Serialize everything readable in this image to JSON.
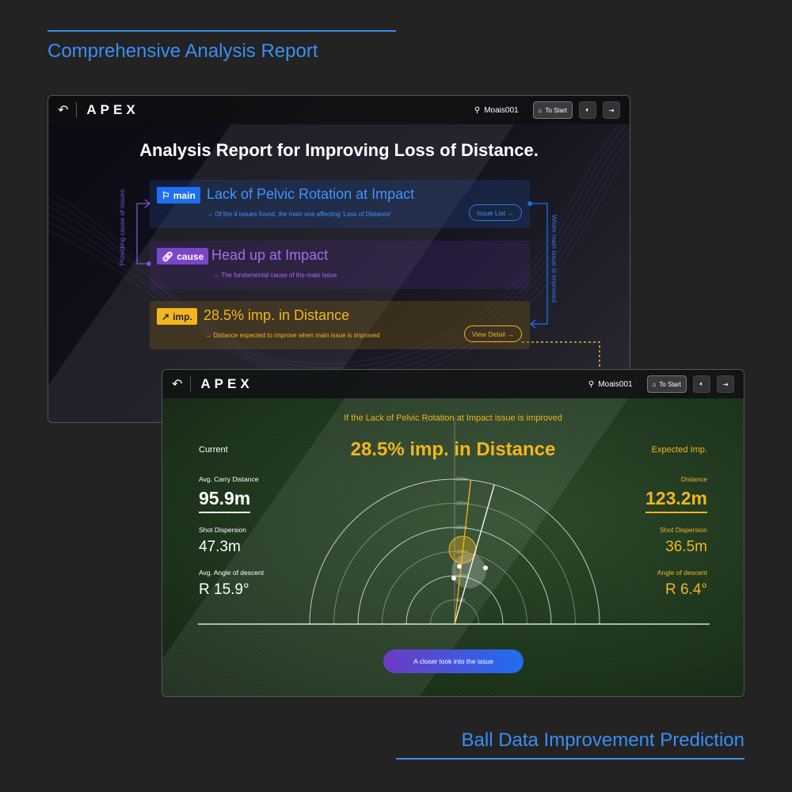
{
  "captions": {
    "top": "Comprehensive Analysis Report",
    "bottom": "Ball Data Improvement Prediction"
  },
  "header": {
    "logo": "APEX",
    "user": "Moais001",
    "to_start": "To Start"
  },
  "report": {
    "title": "Analysis Report for Improving Loss of Distance.",
    "left_flow": "Providing cause of issues",
    "right_flow": "When main issue is improved",
    "cards": [
      {
        "tag": "main",
        "title": "Lack of Pelvic Rotation at Impact",
        "sub": "Of the 4 issues found, the main one affecting 'Loss of Distance'.",
        "button": "Issue List"
      },
      {
        "tag": "cause",
        "title": "Head up at Impact",
        "sub": "The fundamental cause of the main issue"
      },
      {
        "tag": "imp.",
        "title": "28.5% imp. in Distance",
        "sub": "Distance expected to improve when main issue is improved",
        "button": "View Detail"
      }
    ]
  },
  "prediction": {
    "subtitle": "If the Lack of Pelvic Rotation at Impact issue is improved",
    "headline": "28.5% imp. in Distance",
    "current": {
      "heading": "Current",
      "items": [
        {
          "label": "Avg. Carry Distance",
          "value": "95.9m"
        },
        {
          "label": "Shot Dispersion",
          "value": "47.3m"
        },
        {
          "label": "Avg. Angle of descent",
          "value": "R 15.9°"
        }
      ]
    },
    "expected": {
      "heading": "Expected Imp.",
      "items": [
        {
          "label": "Distance",
          "value": "123.2m"
        },
        {
          "label": "Shot Dispersion",
          "value": "36.5m"
        },
        {
          "label": "Angle of descent",
          "value": "R 6.4°"
        }
      ]
    },
    "cta": "A closer look into the issue"
  },
  "chart_data": {
    "type": "scatter",
    "ring_labels": [
      "50m",
      "100m",
      "150m",
      "200m",
      "250m",
      "300m"
    ],
    "rings_m": [
      50,
      100,
      150,
      200,
      250,
      300
    ],
    "current_direction_deg": 15.9,
    "expected_direction_deg": 6.4,
    "colors": {
      "current": "#ffffff",
      "expected": "#f3b61e"
    }
  },
  "colors": {
    "blue": "#1f6ef0",
    "purple": "#8a4fd8",
    "yellow": "#f3b61e",
    "caption": "#3a8ef5"
  }
}
